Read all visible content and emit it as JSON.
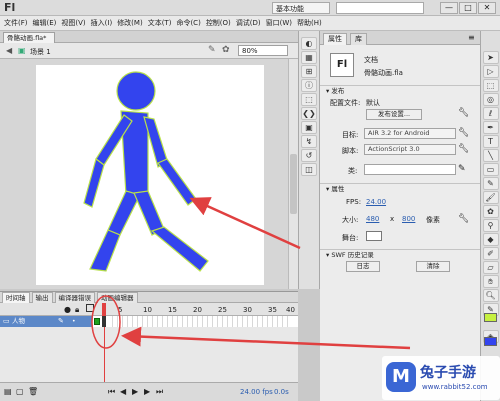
{
  "app": {
    "logo": "Fl",
    "workspace": "基本功能",
    "win_min": "—",
    "win_max": "□",
    "win_close": "✕"
  },
  "menu": [
    "文件(F)",
    "编辑(E)",
    "视图(V)",
    "插入(I)",
    "修改(M)",
    "文本(T)",
    "命令(C)",
    "控制(O)",
    "调试(D)",
    "窗口(W)",
    "帮助(H)"
  ],
  "document": {
    "tab": "骨骼动画.fla*",
    "scene": "场景 1",
    "zoom": "80%"
  },
  "timeline": {
    "tabs": [
      "时间轴",
      "输出",
      "编译器错误",
      "动画编辑器"
    ],
    "frame_numbers": [
      "5",
      "10",
      "15",
      "20",
      "25",
      "30",
      "35",
      "40"
    ],
    "layer_name": "人物",
    "fps": "24.00 fps",
    "time": "0.0s"
  },
  "panel": {
    "tabs": [
      "属性",
      "库"
    ],
    "doc_icon": "Fl",
    "doc_type": "文档",
    "doc_name": "骨骼动画.fla",
    "section_publish": "发布",
    "profile_label": "配置文件:",
    "profile_value": "默认",
    "publish_settings": "发布设置...",
    "target_label": "目标:",
    "target_value": "AIR 3.2 for Android",
    "script_label": "脚本:",
    "script_value": "ActionScript 3.0",
    "class_label": "类:",
    "class_value": "",
    "section_props": "属性",
    "fps_label": "FPS:",
    "fps_value": "24.00",
    "size_label": "大小:",
    "width": "480",
    "x": "x",
    "height": "800",
    "unit": "像素",
    "stage_label": "舞台:",
    "section_swf": "SWF 历史记录",
    "log_button": "日志",
    "clear_button": "清除"
  },
  "watermark": {
    "glyph": "M",
    "title": "兔子手游",
    "url": "www.rabbit52.com"
  },
  "colors": {
    "figure_fill": "#3344ee",
    "figure_outline": "#b8e04a",
    "annotation": "#e04040",
    "layer_highlight": "#5c88c8"
  }
}
